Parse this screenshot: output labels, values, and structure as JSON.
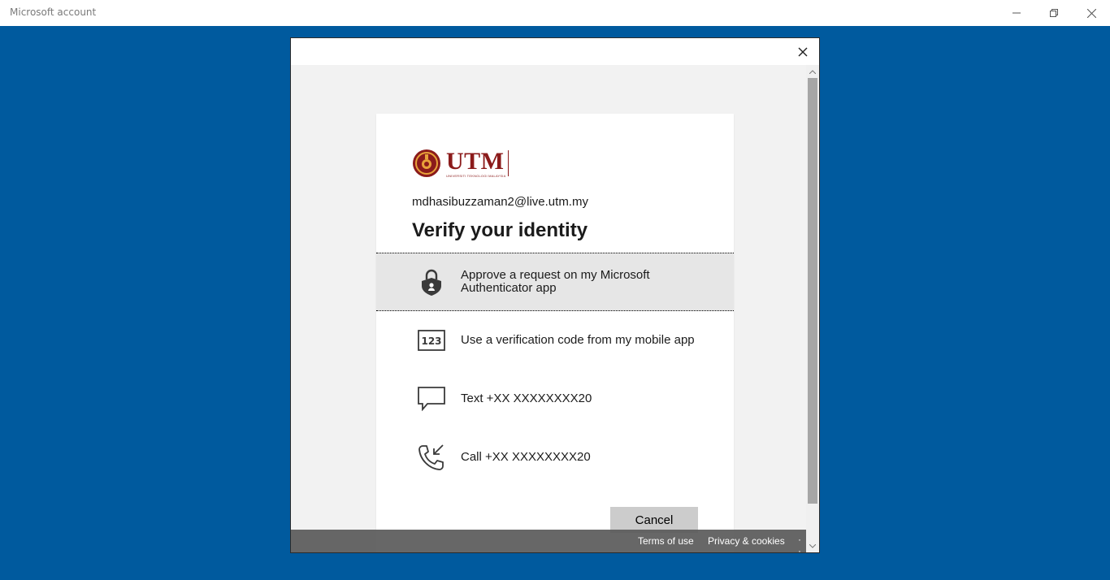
{
  "window": {
    "title": "Microsoft account",
    "minimize_icon": "minimize-icon",
    "restore_icon": "restore-icon",
    "close_icon": "close-icon"
  },
  "dialog": {
    "close_icon": "close-icon"
  },
  "card": {
    "logo": {
      "text": "UTM",
      "subtext": "UNIVERSITI TEKNOLOGI MALAYSIA"
    },
    "email": "mdhasibuzzaman2@live.utm.my",
    "heading": "Verify your identity",
    "options": [
      {
        "label": "Approve a request on my Microsoft Authenticator app",
        "icon": "authenticator-lock-icon",
        "selected": true
      },
      {
        "label": "Use a verification code from my mobile app",
        "icon": "code-123-icon",
        "selected": false
      },
      {
        "label": "Text +XX XXXXXXXX20",
        "icon": "message-icon",
        "selected": false
      },
      {
        "label": "Call +XX XXXXXXXX20",
        "icon": "phone-call-icon",
        "selected": false
      }
    ],
    "cancel_label": "Cancel"
  },
  "footer": {
    "terms": "Terms of use",
    "privacy": "Privacy & cookies",
    "more": "· ·"
  },
  "colors": {
    "desktop_bg": "#005a9e",
    "brand": "#8b1b1b",
    "selected_bg": "#e6e6e6"
  }
}
